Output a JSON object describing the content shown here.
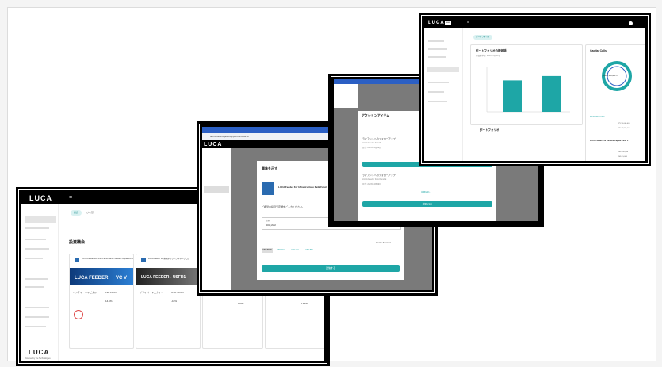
{
  "shot1": {
    "brand": "LUCA",
    "tabs": [
      "投資",
      "ひな形"
    ],
    "section_title": "投資機会",
    "cards": [
      {
        "title": "LUCA Feeder For ESG Performance Venture Capital Fund",
        "banner": "LUCA FEEDER",
        "banner_code": "VC V",
        "manager": "ベンチャーキャピタル",
        "amount": "USD 20.0m",
        "metric": "-14.5%"
      },
      {
        "title": "LUCA Feeder For米国テックベンチャーグロス",
        "banner": "LUCA FEEDER - USFD1",
        "banner_code": "USFD1",
        "manager": "プライベートエクイ...",
        "amount": "USD 50.0m",
        "metric": "-10%"
      },
      {
        "title": "",
        "banner": "",
        "banner_code": "",
        "manager": "プライベート・エクイ...",
        "amount": "USD 50.0m",
        "metric": "100%"
      },
      {
        "title": "",
        "banner": "",
        "banner_code": "",
        "manager": "プライベート・エクイ...",
        "amount": "USD 200.0m",
        "metric": "-14.5%"
      }
    ],
    "footer_brand": "LUCA",
    "footer_powered": "Powered by the Technologies"
  },
  "shot2": {
    "url": "demo.luca.capital/fcp/partnerfund/78",
    "dialog_title": "興味を示す",
    "fund_name": "LUCA Feeder For Infrastructure Debt Fund",
    "prompt": "ご希望の投資予定額をご入力ください。",
    "amount_label": "金額",
    "amount_value": "500,000",
    "quick_label": "Quick Amount",
    "quick_amounts": [
      "USD 500K",
      "USD 1M",
      "USD 2M",
      "USD 5M"
    ],
    "submit": "送信する",
    "left_brand": "LUCA"
  },
  "shot3": {
    "title": "アクションアイテム",
    "items": [
      {
        "title": "ライアントへのフォローアップ",
        "sub": "LUCA Feeder Fund B",
        "date": "日付: 2023年4月19日"
      },
      {
        "title": "ライアントへのフォローアップ",
        "sub": "LUCA Feeder Fund Fund E",
        "date": "日付: 2023年4月19日"
      }
    ],
    "btn1": "詳細を見る",
    "btn2": "詳細を見る",
    "btn3": "詳細を見る"
  },
  "shot4": {
    "brand": "LUCA",
    "brand_badge": "DEMO",
    "pill": "ポートフォリオ",
    "portfolio_title": "ポートフォリオの評価額",
    "portfolio_sub": "評価基準日: 2023年3月31日",
    "portfolio_section": "ポートフォリオ",
    "capital_title": "Capital Calls",
    "donut_label": "USD 1,445,063.27",
    "funds": [
      {
        "name": "MEDTIPA FUND",
        "a": "JPY 50,000,000",
        "b": "JPY 28,848,000"
      },
      {
        "name": "LUCA Feeder For Venture Capital Fund V",
        "a": "USD 100,000",
        "b": "USD 15,000"
      }
    ],
    "bar_values": [
      72,
      82
    ],
    "bar_max": 100
  },
  "colors": {
    "teal": "#1ea6a6",
    "black": "#000000"
  }
}
